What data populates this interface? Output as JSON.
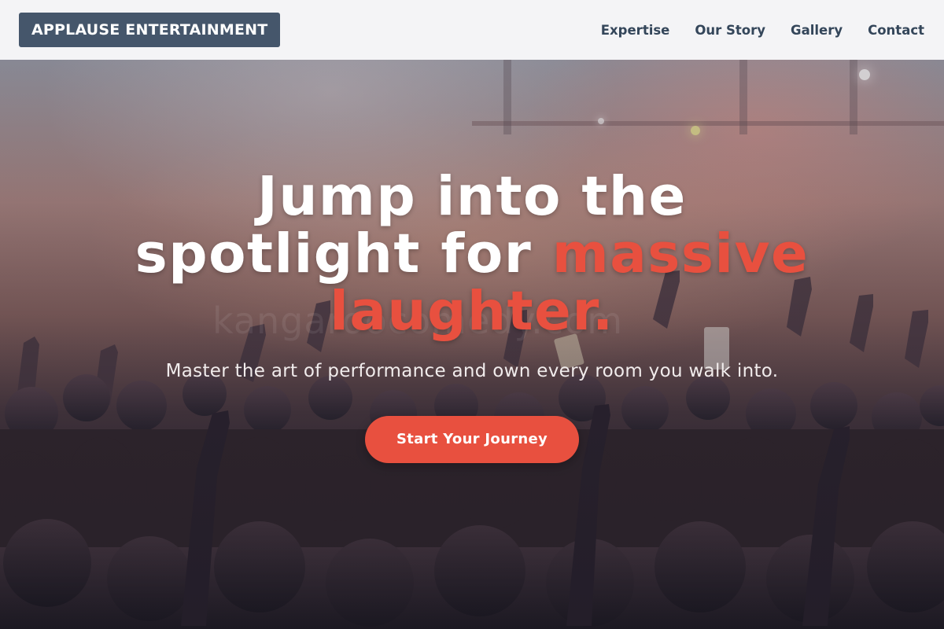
{
  "header": {
    "logo_text": "APPLAUSE ENTERTAINMENT",
    "nav": [
      {
        "label": "Expertise"
      },
      {
        "label": "Our Story"
      },
      {
        "label": "Gallery"
      },
      {
        "label": "Contact"
      }
    ]
  },
  "hero": {
    "headline_part1": "Jump into the spotlight for ",
    "headline_accent": "massive laughter.",
    "subtitle": "Master the art of performance and own every room you walk into.",
    "cta_label": "Start Your Journey",
    "watermark": "kangaroocomedy.com",
    "background_image": "concert-crowd-photo"
  },
  "colors": {
    "accent": "#e8503f",
    "logo_bg": "#45566b",
    "nav_text": "#34465a",
    "header_bg": "#f4f4f6"
  }
}
